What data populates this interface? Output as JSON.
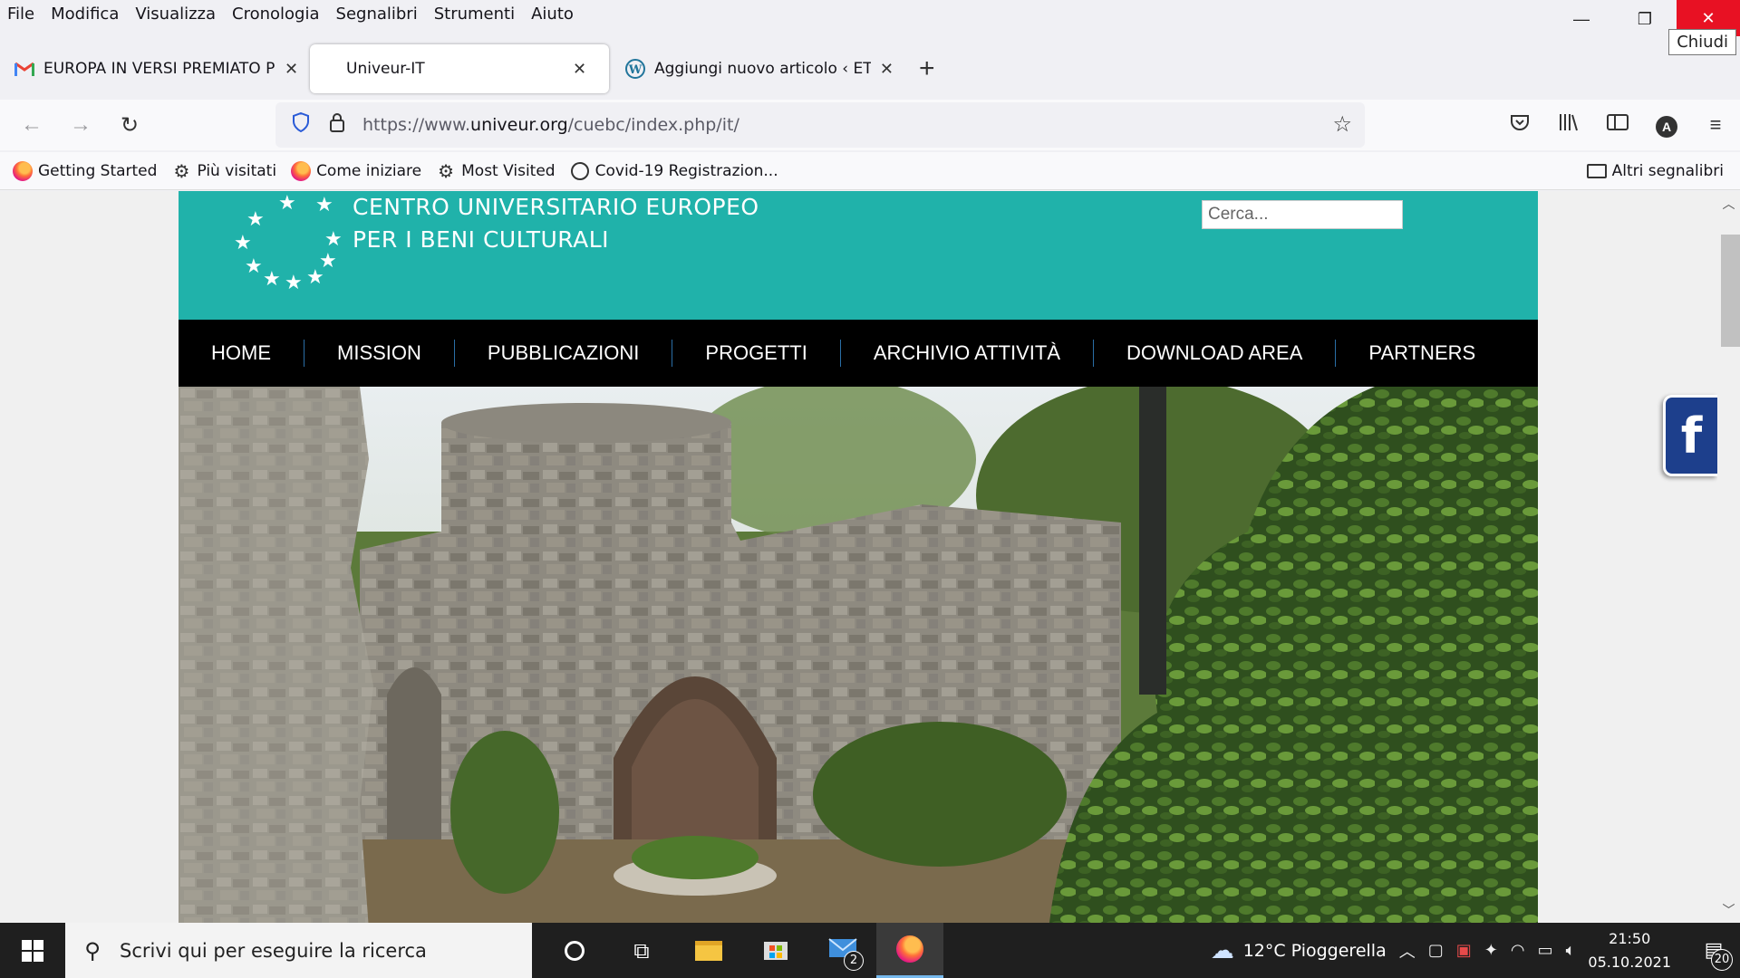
{
  "menubar": {
    "items": [
      "File",
      "Modifica",
      "Visualizza",
      "Cronologia",
      "Segnalibri",
      "Strumenti",
      "Aiuto"
    ],
    "close_tooltip": "Chiudi"
  },
  "tabs": [
    {
      "label": "EUROPA IN VERSI PREMIATO PE",
      "icon": "gmail-icon"
    },
    {
      "label": "Univeur-IT",
      "icon": "none",
      "active": true
    },
    {
      "label": "Aggiungi nuovo articolo ‹ ETiCi",
      "icon": "wordpress-icon"
    }
  ],
  "navbar": {
    "url_prefix": "https://www.",
    "url_domain": "univeur.org",
    "url_path": "/cuebc/index.php/it/"
  },
  "bookmarks": {
    "items": [
      {
        "label": "Getting Started",
        "icon": "firefox-icon"
      },
      {
        "label": "Più visitati",
        "icon": "gear-icon"
      },
      {
        "label": "Come iniziare",
        "icon": "firefox-icon"
      },
      {
        "label": "Most Visited",
        "icon": "gear-icon"
      },
      {
        "label": "Covid-19 Registrazion...",
        "icon": "globe-icon"
      }
    ],
    "other": "Altri segnalibri"
  },
  "site": {
    "logo_line1": "CENTRO UNIVERSITARIO EUROPEO",
    "logo_line2": "PER I BENI CULTURALI",
    "search_placeholder": "Cerca...",
    "nav": [
      "HOME",
      "MISSION",
      "PUBBLICAZIONI",
      "PROGETTI",
      "ARCHIVIO ATTIVITÀ",
      "DOWNLOAD AREA",
      "PARTNERS"
    ],
    "facebook_letter": "f",
    "colors": {
      "header": "#20b2aa",
      "nav": "#000000",
      "facebook": "#1d3f8c"
    }
  },
  "taskbar": {
    "search_placeholder": "Scrivi qui per eseguire la ricerca",
    "mail_badge": "2",
    "weather": "12°C  Pioggerella",
    "time": "21:50",
    "date": "05.10.2021",
    "notifications": "20"
  }
}
